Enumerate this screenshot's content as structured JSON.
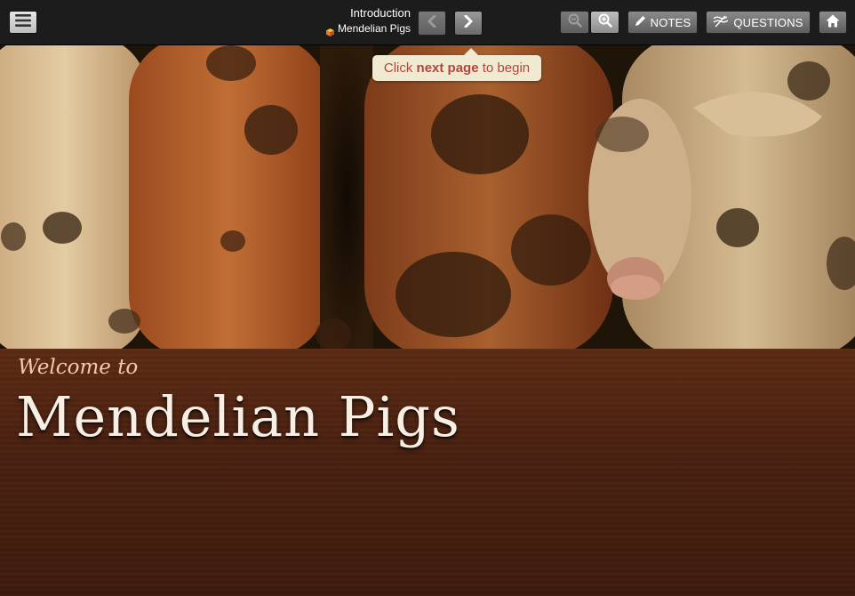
{
  "toolbar": {
    "menu_icon": "hamburger-menu-icon",
    "title": "Introduction",
    "subtitle": "Mendelian Pigs",
    "prev_icon": "chevron-left-icon",
    "next_icon": "chevron-right-icon",
    "zoom_out_icon": "zoom-out-icon",
    "zoom_in_icon": "zoom-in-icon",
    "notes_label": "NOTES",
    "questions_label": "QUESTIONS",
    "home_icon": "home-icon"
  },
  "tooltip": {
    "prefix": "Click ",
    "emphasis": "next page",
    "suffix": " to begin"
  },
  "hero": {
    "image_alt": "pigs-photo"
  },
  "welcome": {
    "intro": "Welcome to",
    "title": "Mendelian Pigs"
  },
  "colors": {
    "toolbar_bg": "#1c1c1c",
    "panel_brown": "#4a2010",
    "tooltip_bg": "#f1ead2",
    "tooltip_text": "#b2463c"
  }
}
